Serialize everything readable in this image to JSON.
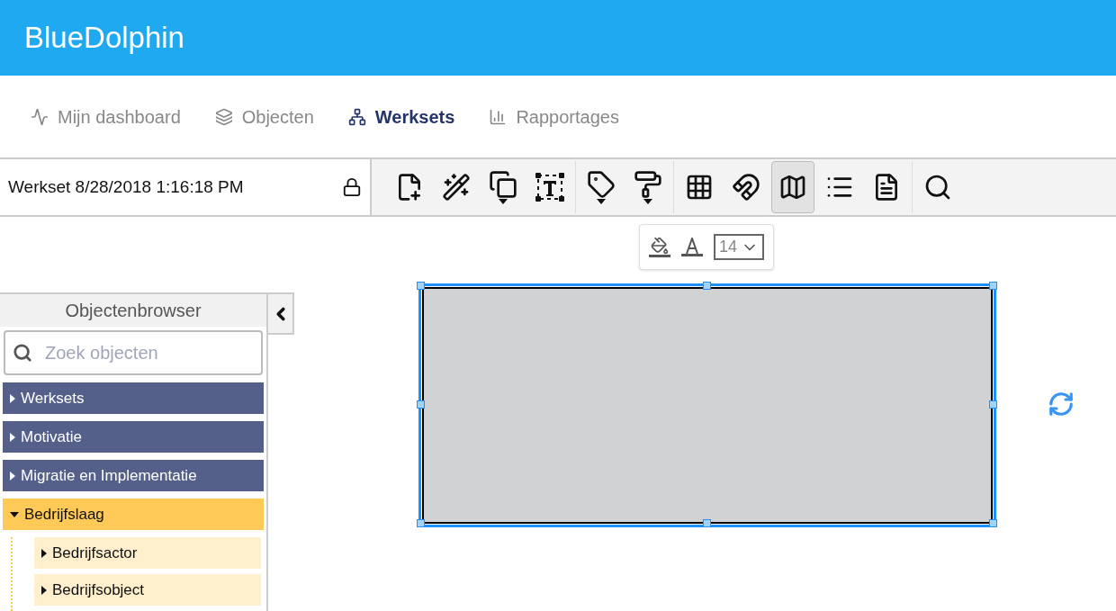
{
  "app": {
    "title": "BlueDolphin"
  },
  "nav": [
    {
      "label": "Mijn dashboard",
      "selected": false
    },
    {
      "label": "Objecten",
      "selected": false
    },
    {
      "label": "Werksets",
      "selected": true
    },
    {
      "label": "Rapportages",
      "selected": false
    }
  ],
  "workset": {
    "name": "Werkset 8/28/2018 1:16:18 PM",
    "locked": true
  },
  "toolbar": {
    "groups": [
      [
        {
          "selected": false,
          "dropdown": false
        },
        {
          "selected": false,
          "dropdown": false
        },
        {
          "selected": false,
          "dropdown": true
        },
        {
          "selected": false,
          "dropdown": false
        }
      ],
      [
        {
          "selected": false,
          "dropdown": true
        },
        {
          "selected": false,
          "dropdown": true
        }
      ],
      [
        {
          "selected": false,
          "dropdown": false
        },
        {
          "selected": false,
          "dropdown": false
        },
        {
          "selected": true,
          "dropdown": false
        },
        {
          "selected": false,
          "dropdown": false
        },
        {
          "selected": false,
          "dropdown": false
        }
      ],
      [
        {
          "selected": false,
          "dropdown": false
        }
      ]
    ]
  },
  "format_popup": {
    "font_size": "14"
  },
  "object_browser": {
    "title": "Objectenbrowser",
    "search": {
      "placeholder": "Zoek objecten"
    },
    "items": [
      {
        "label": "Werksets",
        "expanded": false,
        "color": "#546089"
      },
      {
        "label": "Motivatie",
        "expanded": false,
        "color": "#546089"
      },
      {
        "label": "Migratie en Implementatie",
        "expanded": false,
        "color": "#546089"
      },
      {
        "label": "Bedrijfslaag",
        "expanded": true,
        "color": "#fec956",
        "children": [
          {
            "label": "Bedrijfsactor",
            "expanded": false
          },
          {
            "label": "Bedrijfsobject",
            "expanded": false
          }
        ]
      }
    ]
  }
}
